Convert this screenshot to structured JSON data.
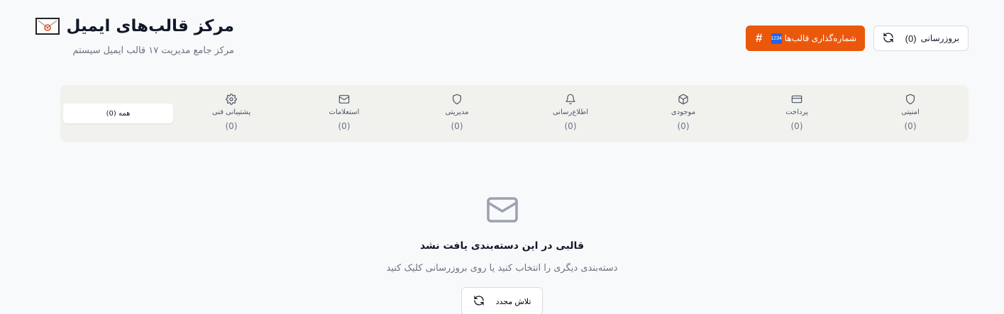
{
  "header": {
    "title": "مرکز قالب‌های ایمیل",
    "title_icon": "envelope-with-arrow-emoji",
    "subtitle": "مرکز جامع مدیریت ۱۷ قالب ایمیل سیستم"
  },
  "actions": {
    "numbering_label": "شماره‌گذاری قالب‌ها",
    "numbering_emoji": "1234",
    "numbering_icon": "hash-icon",
    "refresh_label": "بروزرسانی",
    "refresh_count": "(0)",
    "refresh_icon": "refresh-icon",
    "primary_color": "#ea580c"
  },
  "tabs": {
    "all_label": "همه (0)",
    "items": [
      {
        "label": "امنیتی",
        "count": "(0)",
        "icon": "shield-icon"
      },
      {
        "label": "پرداخت",
        "count": "(0)",
        "icon": "credit-card-icon"
      },
      {
        "label": "موجودی",
        "count": "(0)",
        "icon": "package-icon"
      },
      {
        "label": "اطلاع‌رسانی",
        "count": "(0)",
        "icon": "bell-icon"
      },
      {
        "label": "مدیریتی",
        "count": "(0)",
        "icon": "shield-icon"
      },
      {
        "label": "استعلامات",
        "count": "(0)",
        "icon": "mail-icon"
      },
      {
        "label": "پشتیبانی فنی",
        "count": "(0)",
        "icon": "gear-icon"
      }
    ]
  },
  "empty_state": {
    "icon": "mail-icon",
    "title": "قالبی در این دسته‌بندی یافت نشد",
    "description": "دسته‌بندی دیگری را انتخاب کنید یا روی بروزرسانی کلیک کنید",
    "retry_label": "تلاش مجدد"
  }
}
